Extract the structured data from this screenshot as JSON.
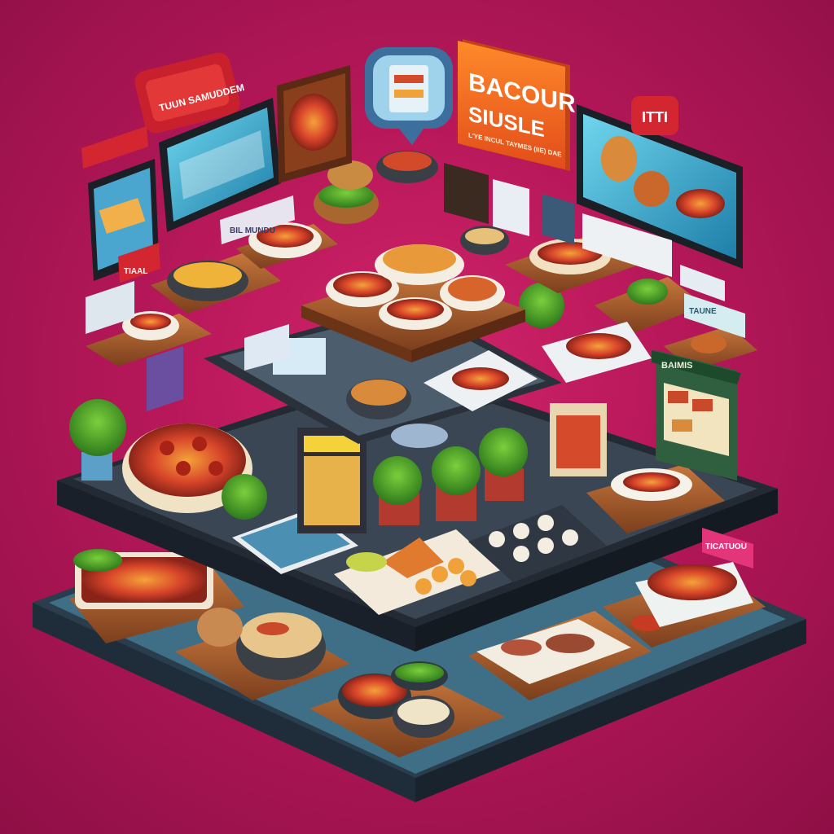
{
  "signs": {
    "main_line1": "BACOUR",
    "main_line2": "SIUSLE",
    "main_sub": "L'YE INCUL TAYMES (IIE) DAE",
    "top_left": "TUUN SAMUDDEM",
    "top_right": "ITTI",
    "mid_left": "BIL MUNDU",
    "right_small": "TAUNE",
    "stall_right": "BAIMIS",
    "bottom_right": "TICATUOU",
    "banner_left": "TIAAL"
  },
  "colors": {
    "background": "#b8185a",
    "platform_blue": "#3f6f86",
    "platform_dark": "#2b3440",
    "wood": "#a0582c",
    "sign_orange": "#f36d22",
    "sign_red": "#d32630"
  }
}
